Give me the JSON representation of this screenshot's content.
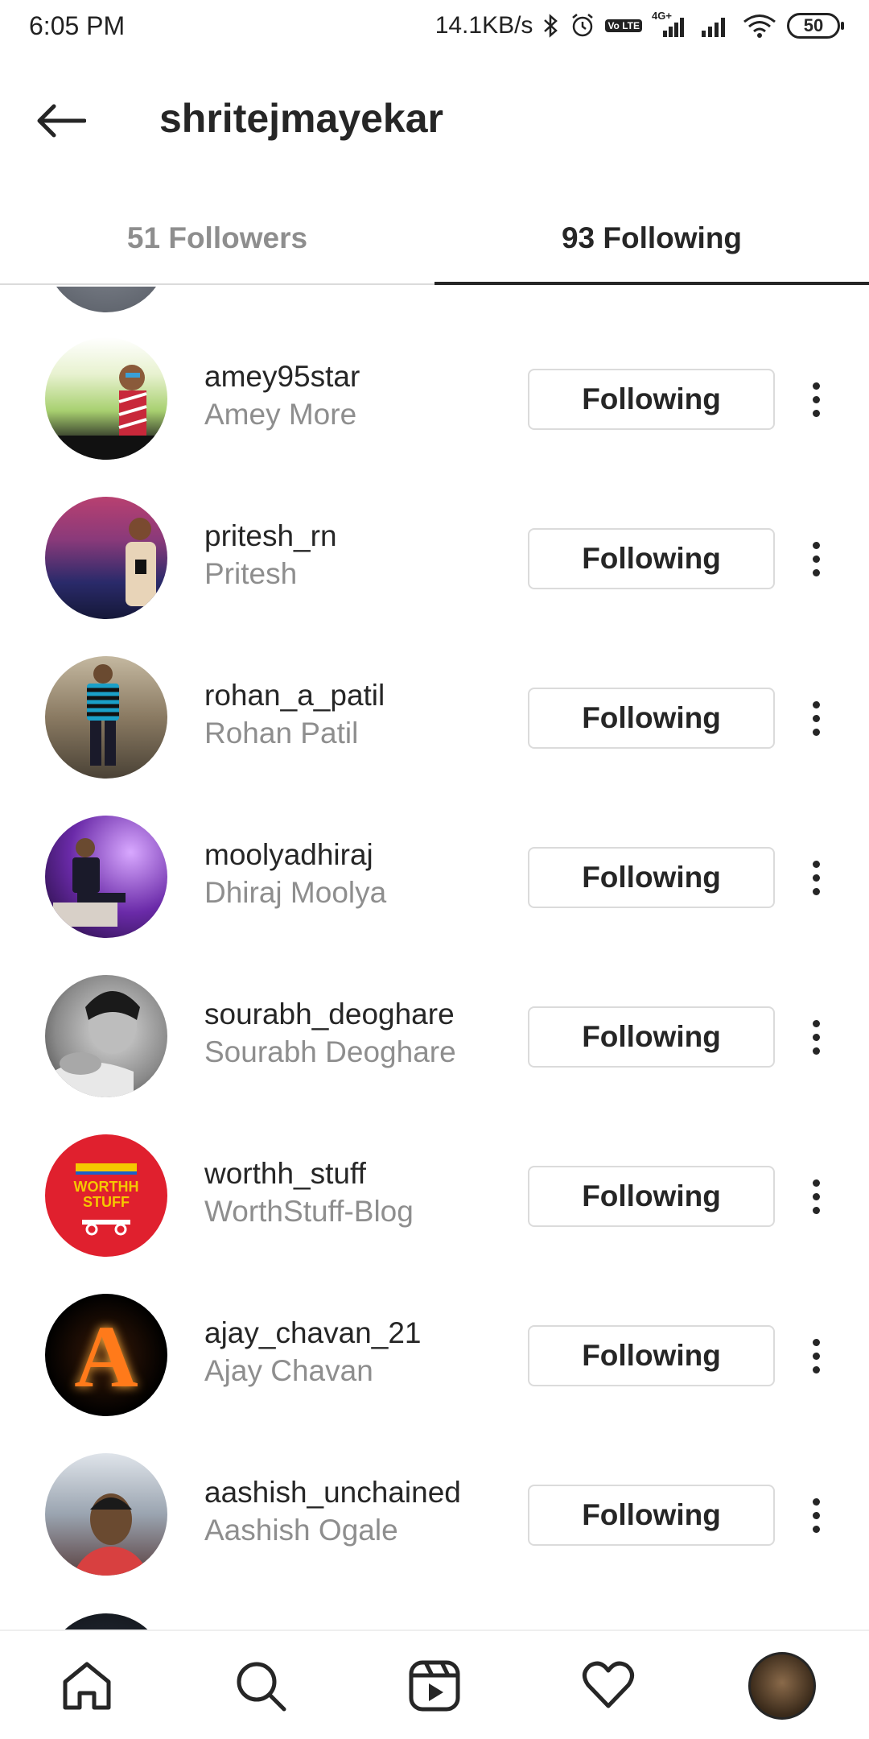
{
  "status_bar": {
    "time": "6:05 PM",
    "net_speed": "14.1KB/s",
    "network_label": "4G+",
    "volte_label": "Vo LTE",
    "battery": "50",
    "icons": [
      "bluetooth-icon",
      "alarm-icon",
      "volte-icon",
      "signal-icon",
      "signal-icon-2",
      "wifi-icon",
      "battery-icon"
    ]
  },
  "header": {
    "title": "shritejmayekar",
    "back_icon": "arrow-left-icon"
  },
  "tabs": [
    {
      "label": "51 Followers",
      "active": false
    },
    {
      "label": "93 Following",
      "active": true
    }
  ],
  "following": [
    {
      "username": "amey95star",
      "fullname": "Amey More",
      "button": "Following"
    },
    {
      "username": "pritesh_rn",
      "fullname": "Pritesh",
      "button": "Following"
    },
    {
      "username": "rohan_a_patil",
      "fullname": "Rohan Patil",
      "button": "Following"
    },
    {
      "username": "moolyadhiraj",
      "fullname": "Dhiraj Moolya",
      "button": "Following"
    },
    {
      "username": "sourabh_deoghare",
      "fullname": "Sourabh Deoghare",
      "button": "Following"
    },
    {
      "username": "worthh_stuff",
      "fullname": "WorthStuff-Blog",
      "button": "Following",
      "avatar_text": "WORTHH STUFF"
    },
    {
      "username": "ajay_chavan_21",
      "fullname": "Ajay Chavan",
      "button": "Following",
      "avatar_text": "A"
    },
    {
      "username": "aashish_unchained",
      "fullname": "Aashish Ogale",
      "button": "Following"
    }
  ],
  "bottom_nav": {
    "items": [
      "home-icon",
      "search-icon",
      "reels-icon",
      "heart-icon",
      "profile-avatar"
    ]
  },
  "colors": {
    "text_primary": "#262626",
    "text_secondary": "#8e8e8e",
    "border": "#dbdbdb"
  }
}
